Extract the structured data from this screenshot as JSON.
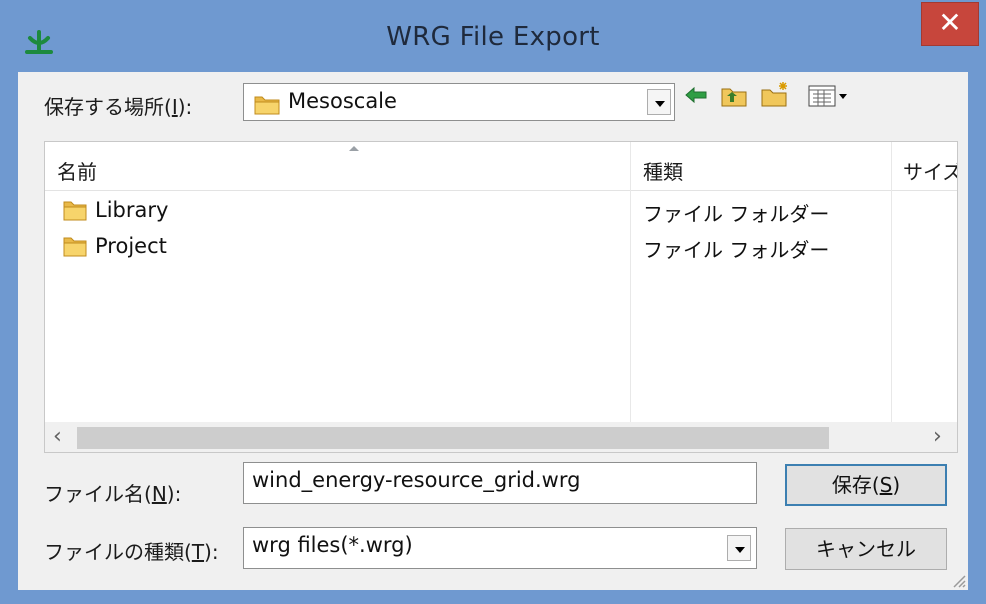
{
  "window": {
    "title": "WRG File Export",
    "close_label": "✕",
    "app_icon": "tree-icon",
    "colors": {
      "frame": "#6f99d0",
      "close": "#c7463c",
      "accent": "#3c7fb1"
    }
  },
  "location": {
    "label": "保存する場所(",
    "label_key": "I",
    "label_tail": "):",
    "value": "Mesoscale",
    "toolbar": [
      "back-arrow-icon",
      "up-folder-icon",
      "new-folder-icon",
      "view-menu-icon"
    ]
  },
  "file_list": {
    "columns": [
      "名前",
      "種類",
      "サイズ"
    ],
    "rows": [
      {
        "name": "Library",
        "type": "ファイル フォルダー"
      },
      {
        "name": "Project",
        "type": "ファイル フォルダー"
      }
    ]
  },
  "file_name": {
    "label": "ファイル名(",
    "label_key": "N",
    "label_tail": "):",
    "value": "wind_energy-resource_grid.wrg"
  },
  "file_type": {
    "label": "ファイルの種類(",
    "label_key": "T",
    "label_tail": "):",
    "value": "wrg files(*.wrg)"
  },
  "buttons": {
    "save": {
      "label": "保存(",
      "key": "S",
      "tail": ")"
    },
    "cancel": {
      "label": "キャンセル"
    }
  }
}
